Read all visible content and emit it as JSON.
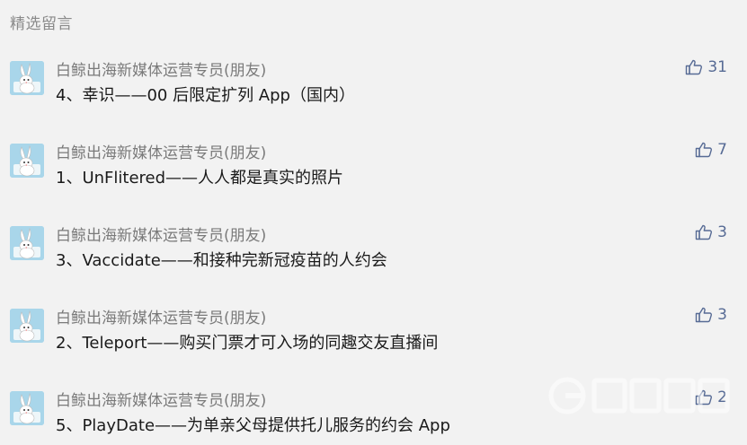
{
  "section_title": "精选留言",
  "colors": {
    "background": "#f2f2f2",
    "nickname": "#7a7a7a",
    "content": "#1a1a1a",
    "like_accent": "#576b95",
    "avatar_bg": "#a9d6ea"
  },
  "comments": [
    {
      "nickname": "白鲸出海新媒体运营专员(朋友)",
      "content": "4、幸识——00 后限定扩列 App（国内）",
      "likes": "31",
      "avatar_icon": "rabbit-avatar-icon",
      "like_icon": "thumbs-up-icon"
    },
    {
      "nickname": "白鲸出海新媒体运营专员(朋友)",
      "content": "1、UnFlitered——人人都是真实的照片",
      "likes": "7",
      "avatar_icon": "rabbit-avatar-icon",
      "like_icon": "thumbs-up-icon"
    },
    {
      "nickname": "白鲸出海新媒体运营专员(朋友)",
      "content": "3、Vaccidate——和接种完新冠疫苗的人约会",
      "likes": "3",
      "avatar_icon": "rabbit-avatar-icon",
      "like_icon": "thumbs-up-icon"
    },
    {
      "nickname": "白鲸出海新媒体运营专员(朋友)",
      "content": "2、Teleport——购买门票才可入场的同趣交友直播间",
      "likes": "3",
      "avatar_icon": "rabbit-avatar-icon",
      "like_icon": "thumbs-up-icon"
    },
    {
      "nickname": "白鲸出海新媒体运营专员(朋友)",
      "content": "5、PlayDate——为单亲父母提供托儿服务的约会 App",
      "likes": "2",
      "avatar_icon": "rabbit-avatar-icon",
      "like_icon": "thumbs-up-icon"
    }
  ]
}
